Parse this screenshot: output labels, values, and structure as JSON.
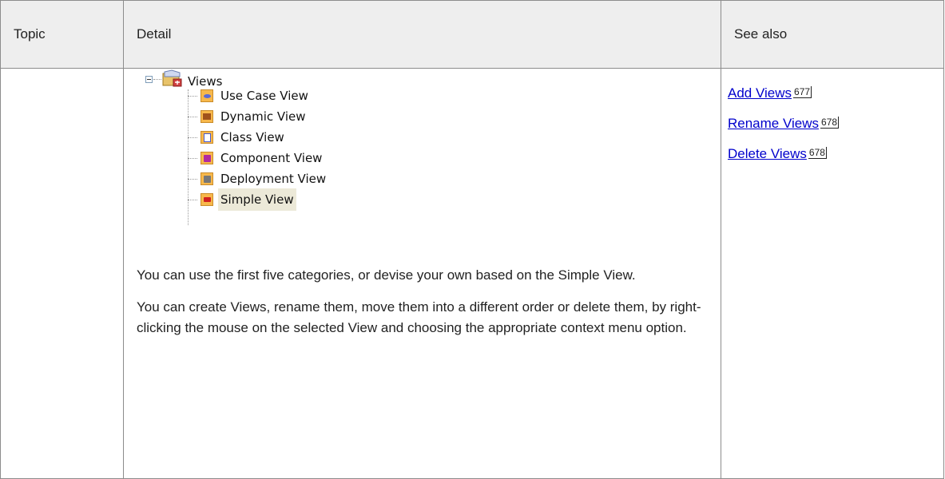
{
  "table": {
    "headers": {
      "topic": "Topic",
      "detail": "Detail",
      "see_also": "See also"
    }
  },
  "tree": {
    "root": {
      "label": "Views",
      "icon": "views-folder-icon"
    },
    "items": [
      {
        "label": "Use Case View",
        "icon": "use-case-view-icon",
        "color": "#5a6bd6"
      },
      {
        "label": "Dynamic View",
        "icon": "dynamic-view-icon",
        "color": "#a0521b"
      },
      {
        "label": "Class View",
        "icon": "class-view-icon",
        "color": "#4a5bd0"
      },
      {
        "label": "Component View",
        "icon": "component-view-icon",
        "color": "#b02aa0"
      },
      {
        "label": "Deployment View",
        "icon": "deployment-view-icon",
        "color": "#777777"
      },
      {
        "label": "Simple View",
        "icon": "simple-view-icon",
        "color": "#d02020",
        "selected": true
      }
    ]
  },
  "detail": {
    "paragraphs": [
      "You can use the first five categories, or devise your own based on the Simple View.",
      "You can create Views, rename them, move them into a different order or delete them, by right-clicking the mouse on the selected View and choosing the appropriate context menu option."
    ]
  },
  "see_also": {
    "links": [
      {
        "label": "Add Views",
        "page": "677"
      },
      {
        "label": "Rename Views",
        "page": "678"
      },
      {
        "label": "Delete Views",
        "page": "678"
      }
    ],
    "link_color": "#0000cc"
  }
}
